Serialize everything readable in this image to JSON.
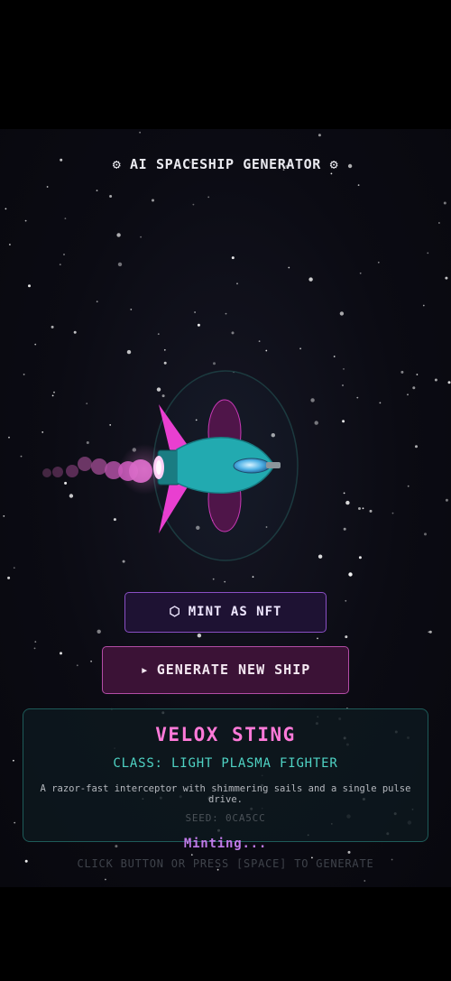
{
  "app": {
    "title": "AI SPACESHIP GENERATOR",
    "title_icon": "gear-icon"
  },
  "buttons": {
    "mint": {
      "label": "MINT AS NFT",
      "icon": "hexagon-icon",
      "glyph": "⬡"
    },
    "generate": {
      "label": "GENERATE NEW SHIP",
      "icon": "play-icon",
      "glyph": "▸"
    }
  },
  "ship": {
    "name": "VELOX STING",
    "class_label": "CLASS: LIGHT PLASMA FIGHTER",
    "description": "A razor-fast interceptor with shimmering sails and a single pulse drive.",
    "seed_label": "SEED: 0CA5CC",
    "hull_color": "#22aab0",
    "fin_color": "#e93fd0",
    "sail_color": "#7a1e6e",
    "exhaust_color": "#d063c0",
    "cockpit_color": "#4fb2e6"
  },
  "status": {
    "minting_text": "Minting...",
    "hint_text": "CLICK BUTTON OR PRESS [SPACE] TO GENERATE"
  },
  "theme": {
    "accent_pink": "#ff7ad9",
    "accent_teal": "#4fd3c4",
    "accent_purple": "#8a4fc4",
    "background": "#0b0b13"
  }
}
